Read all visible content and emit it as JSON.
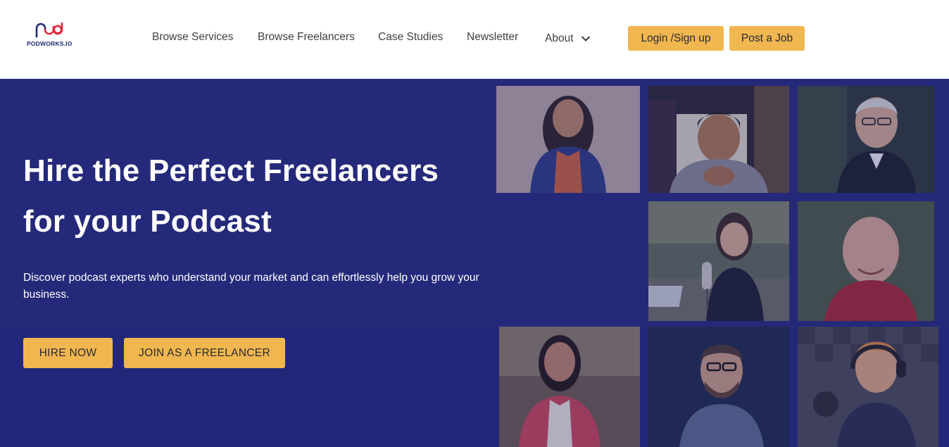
{
  "brand": {
    "name": "PODWORKS.IO",
    "logo_icon": "pwd-monogram-icon",
    "colors": {
      "navy": "#25297a",
      "gold": "#f0b64f",
      "red": "#e2263d"
    }
  },
  "nav": {
    "items": [
      {
        "label": "Browse Services"
      },
      {
        "label": "Browse Freelancers"
      },
      {
        "label": "Case Studies"
      },
      {
        "label": "Newsletter"
      },
      {
        "label": "About",
        "icon": "chevron-down-icon"
      }
    ],
    "login_label": "Login /Sign up",
    "post_job_label": "Post a Job"
  },
  "hero": {
    "title_line1": "Hire the Perfect Freelancers",
    "title_line2": "for your Podcast",
    "subtitle": "Discover podcast experts who understand your market and can effortlessly help you grow your business.",
    "hire_label": "HIRE NOW",
    "join_label": "JOIN AS A FREELANCER"
  },
  "photos": [
    {
      "name": "freelancer-photo-1",
      "description_icon": "woman-orange-shirt"
    },
    {
      "name": "freelancer-photo-2",
      "description_icon": "man-hands-clasped"
    },
    {
      "name": "freelancer-photo-3",
      "description_icon": "man-glasses-suit"
    },
    {
      "name": "freelancer-photo-4",
      "description_icon": "woman-microphone"
    },
    {
      "name": "freelancer-photo-5",
      "description_icon": "bald-man-red-shirt"
    },
    {
      "name": "freelancer-photo-6",
      "description_icon": "woman-red-cardigan"
    },
    {
      "name": "freelancer-photo-7",
      "description_icon": "man-glasses-beard"
    },
    {
      "name": "freelancer-photo-8",
      "description_icon": "woman-headphones-studio"
    }
  ]
}
